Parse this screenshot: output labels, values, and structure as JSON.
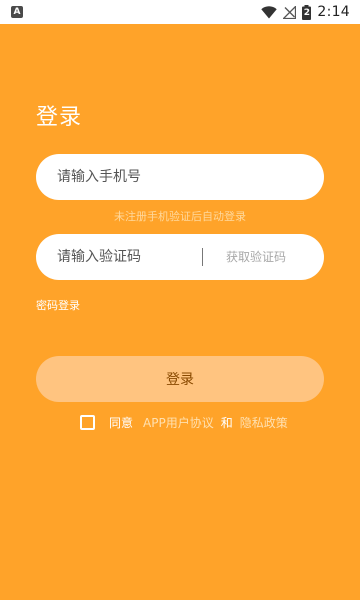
{
  "status_bar": {
    "notification_icon": "A",
    "time": "2:14",
    "battery_level": "2"
  },
  "login": {
    "title": "登录",
    "phone_placeholder": "请输入手机号",
    "hint": "未注册手机验证后自动登录",
    "code_placeholder": "请输入验证码",
    "get_code_label": "获取验证码",
    "password_login_label": "密码登录",
    "submit_label": "登录",
    "agree_text": "同意",
    "user_agreement_label": "APP用户协议",
    "and_text": "和",
    "privacy_label": "隐私政策"
  },
  "colors": {
    "background": "#FFA329",
    "button": "#FFC480",
    "button_text": "#8A4A00",
    "link": "#FFE0B0"
  }
}
